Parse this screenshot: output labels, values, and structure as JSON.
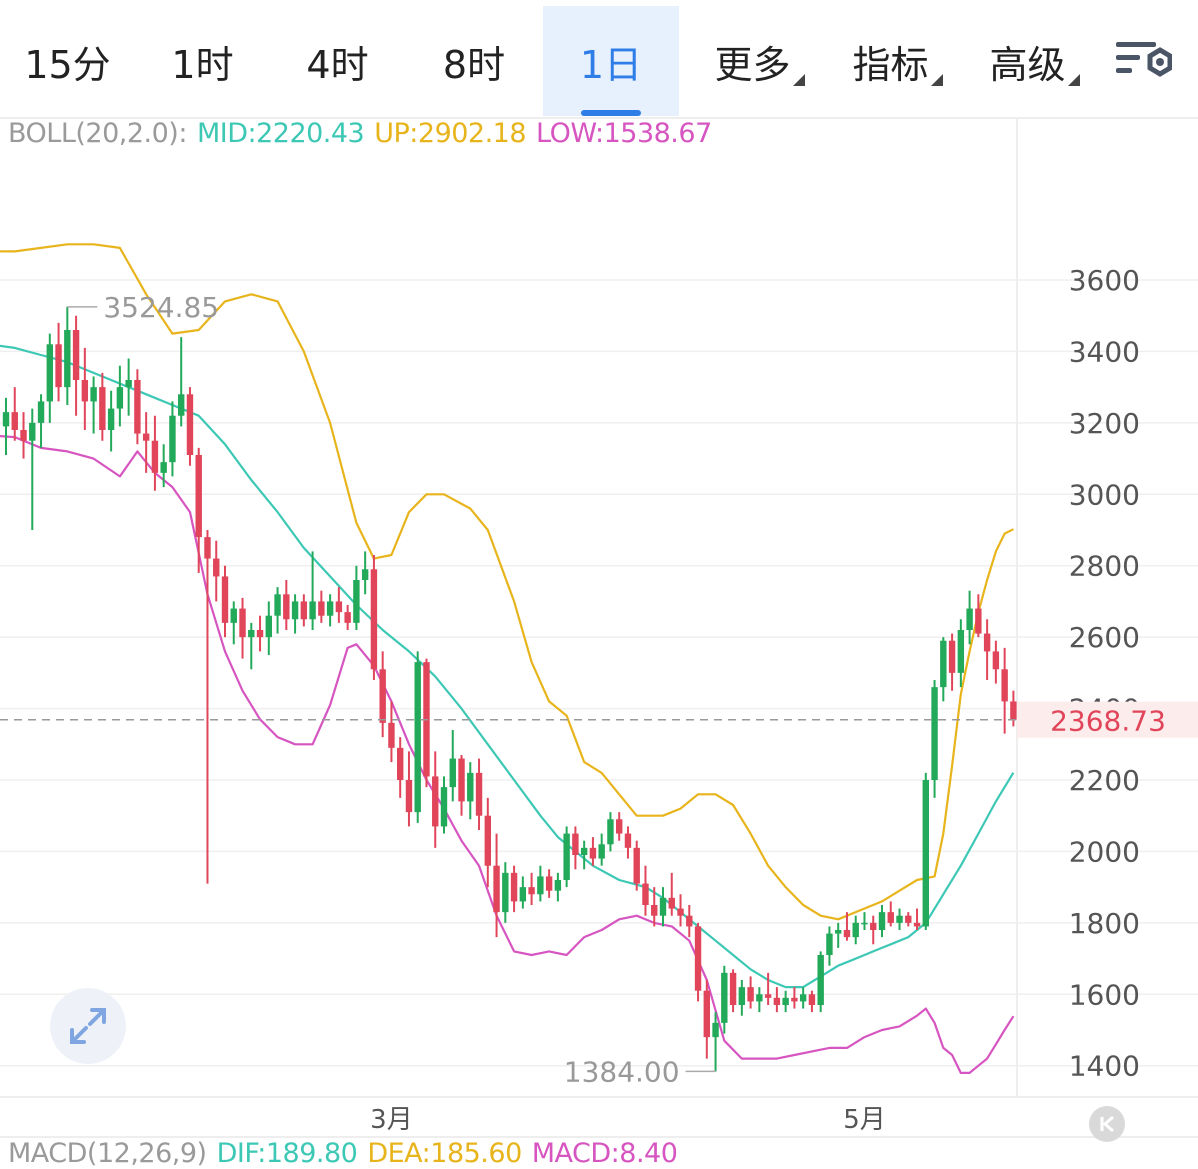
{
  "tabs": [
    {
      "label": "15分",
      "active": false,
      "dropdown": false
    },
    {
      "label": "1时",
      "active": false,
      "dropdown": false
    },
    {
      "label": "4时",
      "active": false,
      "dropdown": false
    },
    {
      "label": "8时",
      "active": false,
      "dropdown": false
    },
    {
      "label": "1日",
      "active": true,
      "dropdown": false
    },
    {
      "label": "更多",
      "active": false,
      "dropdown": true
    },
    {
      "label": "指标",
      "active": false,
      "dropdown": true
    },
    {
      "label": "高级",
      "active": false,
      "dropdown": true
    }
  ],
  "settings_icon": "chart-settings-icon",
  "boll_legend": {
    "name": "BOLL(20,2.0):",
    "mid": "MID:2220.43",
    "up": "UP:2902.18",
    "low": "LOW:1538.67"
  },
  "macd_legend": {
    "name": "MACD(12,26,9)",
    "dif": "DIF:189.80",
    "dea": "DEA:185.60",
    "macd": "MACD:8.40"
  },
  "colors": {
    "up": "#22a95a",
    "down": "#e0455a",
    "mid": "#3cc8b4",
    "upper": "#e8b41c",
    "lower": "#d655c0",
    "current_price_bg": "#fdecec",
    "current_price_text": "#e0455a",
    "axis_text": "#555555",
    "legend_name": "#999999",
    "tab_active": "#2f7ee8"
  },
  "chart_data": {
    "type": "candlestick",
    "period": "1日",
    "ylim": [
      1350,
      3720
    ],
    "y_ticks": [
      1400,
      1600,
      1800,
      2000,
      2200,
      2400,
      2600,
      2800,
      3000,
      3200,
      3400,
      3600
    ],
    "x_labels": [
      {
        "label": "3月",
        "index": 44
      },
      {
        "label": "5月",
        "index": 98
      }
    ],
    "current_price": "2368.73",
    "high_marker": {
      "label": "3524.85",
      "index": 7,
      "value": 3524.85
    },
    "low_marker": {
      "label": "1384.00",
      "index": 81,
      "value": 1384.0
    },
    "ohlc": [
      [
        3190,
        3270,
        3110,
        3230
      ],
      [
        3230,
        3300,
        3150,
        3180
      ],
      [
        3180,
        3230,
        3100,
        3150
      ],
      [
        3150,
        3240,
        2900,
        3200
      ],
      [
        3200,
        3280,
        3130,
        3260
      ],
      [
        3260,
        3450,
        3200,
        3420
      ],
      [
        3420,
        3480,
        3260,
        3300
      ],
      [
        3300,
        3524.85,
        3250,
        3460
      ],
      [
        3460,
        3500,
        3220,
        3320
      ],
      [
        3320,
        3410,
        3180,
        3260
      ],
      [
        3260,
        3330,
        3170,
        3300
      ],
      [
        3300,
        3340,
        3150,
        3180
      ],
      [
        3180,
        3290,
        3120,
        3240
      ],
      [
        3240,
        3360,
        3190,
        3300
      ],
      [
        3300,
        3380,
        3220,
        3320
      ],
      [
        3320,
        3350,
        3140,
        3170
      ],
      [
        3170,
        3230,
        3060,
        3150
      ],
      [
        3150,
        3220,
        3010,
        3060
      ],
      [
        3060,
        3140,
        3020,
        3090
      ],
      [
        3090,
        3260,
        3050,
        3220
      ],
      [
        3220,
        3440,
        3190,
        3280
      ],
      [
        3280,
        3300,
        3080,
        3110
      ],
      [
        3110,
        3130,
        2780,
        2880
      ],
      [
        2880,
        2900,
        1910,
        2820
      ],
      [
        2820,
        2870,
        2700,
        2770
      ],
      [
        2770,
        2800,
        2600,
        2640
      ],
      [
        2640,
        2700,
        2580,
        2680
      ],
      [
        2680,
        2710,
        2540,
        2600
      ],
      [
        2600,
        2640,
        2510,
        2620
      ],
      [
        2620,
        2660,
        2560,
        2600
      ],
      [
        2600,
        2700,
        2550,
        2660
      ],
      [
        2660,
        2740,
        2610,
        2720
      ],
      [
        2720,
        2760,
        2620,
        2650
      ],
      [
        2650,
        2720,
        2610,
        2700
      ],
      [
        2700,
        2720,
        2630,
        2650
      ],
      [
        2650,
        2840,
        2620,
        2700
      ],
      [
        2700,
        2730,
        2640,
        2660
      ],
      [
        2660,
        2720,
        2630,
        2700
      ],
      [
        2700,
        2740,
        2640,
        2670
      ],
      [
        2670,
        2690,
        2620,
        2640
      ],
      [
        2640,
        2800,
        2620,
        2760
      ],
      [
        2760,
        2840,
        2720,
        2790
      ],
      [
        2790,
        2830,
        2480,
        2510
      ],
      [
        2510,
        2560,
        2320,
        2360
      ],
      [
        2360,
        2420,
        2250,
        2290
      ],
      [
        2290,
        2320,
        2150,
        2200
      ],
      [
        2200,
        2280,
        2070,
        2110
      ],
      [
        2110,
        2560,
        2080,
        2530
      ],
      [
        2530,
        2540,
        2180,
        2210
      ],
      [
        2210,
        2280,
        2010,
        2070
      ],
      [
        2070,
        2210,
        2050,
        2180
      ],
      [
        2180,
        2340,
        2140,
        2260
      ],
      [
        2260,
        2270,
        2100,
        2140
      ],
      [
        2140,
        2250,
        2090,
        2220
      ],
      [
        2220,
        2260,
        2060,
        2100
      ],
      [
        2100,
        2150,
        1900,
        1960
      ],
      [
        1960,
        2050,
        1760,
        1830
      ],
      [
        1830,
        1970,
        1800,
        1940
      ],
      [
        1940,
        1960,
        1830,
        1860
      ],
      [
        1860,
        1930,
        1840,
        1900
      ],
      [
        1900,
        1940,
        1850,
        1880
      ],
      [
        1880,
        1960,
        1860,
        1930
      ],
      [
        1930,
        1950,
        1870,
        1890
      ],
      [
        1890,
        1940,
        1860,
        1920
      ],
      [
        1920,
        2070,
        1900,
        2050
      ],
      [
        2050,
        2070,
        1950,
        1990
      ],
      [
        1990,
        2030,
        1950,
        2010
      ],
      [
        2010,
        2040,
        1960,
        1980
      ],
      [
        1980,
        2050,
        1960,
        2020
      ],
      [
        2020,
        2110,
        2000,
        2090
      ],
      [
        2090,
        2110,
        2030,
        2050
      ],
      [
        2050,
        2070,
        1980,
        2010
      ],
      [
        2010,
        2030,
        1890,
        1910
      ],
      [
        1910,
        1960,
        1820,
        1850
      ],
      [
        1850,
        1900,
        1790,
        1820
      ],
      [
        1820,
        1900,
        1790,
        1870
      ],
      [
        1870,
        1940,
        1820,
        1840
      ],
      [
        1840,
        1880,
        1790,
        1820
      ],
      [
        1820,
        1850,
        1760,
        1790
      ],
      [
        1790,
        1800,
        1580,
        1610
      ],
      [
        1610,
        1640,
        1420,
        1480
      ],
      [
        1480,
        1550,
        1384.0,
        1520
      ],
      [
        1520,
        1680,
        1490,
        1660
      ],
      [
        1660,
        1670,
        1550,
        1570
      ],
      [
        1570,
        1640,
        1540,
        1620
      ],
      [
        1620,
        1650,
        1560,
        1580
      ],
      [
        1580,
        1620,
        1550,
        1600
      ],
      [
        1600,
        1660,
        1570,
        1590
      ],
      [
        1590,
        1620,
        1550,
        1570
      ],
      [
        1570,
        1610,
        1550,
        1590
      ],
      [
        1590,
        1620,
        1560,
        1580
      ],
      [
        1580,
        1620,
        1560,
        1600
      ],
      [
        1600,
        1610,
        1550,
        1570
      ],
      [
        1570,
        1720,
        1550,
        1710
      ],
      [
        1710,
        1790,
        1680,
        1770
      ],
      [
        1770,
        1800,
        1730,
        1780
      ],
      [
        1780,
        1830,
        1750,
        1760
      ],
      [
        1760,
        1820,
        1740,
        1800
      ],
      [
        1800,
        1830,
        1780,
        1800
      ],
      [
        1800,
        1820,
        1740,
        1780
      ],
      [
        1780,
        1850,
        1760,
        1830
      ],
      [
        1830,
        1860,
        1790,
        1800
      ],
      [
        1800,
        1840,
        1780,
        1820
      ],
      [
        1820,
        1830,
        1790,
        1800
      ],
      [
        1800,
        1840,
        1780,
        1790
      ],
      [
        1790,
        2220,
        1780,
        2200
      ],
      [
        2200,
        2480,
        2150,
        2460
      ],
      [
        2460,
        2600,
        2420,
        2590
      ],
      [
        2590,
        2610,
        2450,
        2500
      ],
      [
        2500,
        2650,
        2460,
        2620
      ],
      [
        2620,
        2730,
        2580,
        2680
      ],
      [
        2680,
        2720,
        2600,
        2610
      ],
      [
        2610,
        2650,
        2480,
        2560
      ],
      [
        2560,
        2590,
        2470,
        2510
      ],
      [
        2510,
        2570,
        2330,
        2420
      ],
      [
        2420,
        2450,
        2350,
        2368.73
      ]
    ],
    "boll_upper": [
      [
        -5,
        3680
      ],
      [
        1,
        3680
      ],
      [
        4,
        3690
      ],
      [
        7,
        3700
      ],
      [
        10,
        3700
      ],
      [
        13,
        3690
      ],
      [
        16,
        3560
      ],
      [
        19,
        3450
      ],
      [
        22,
        3460
      ],
      [
        25,
        3540
      ],
      [
        28,
        3560
      ],
      [
        31,
        3540
      ],
      [
        34,
        3400
      ],
      [
        37,
        3200
      ],
      [
        40,
        2920
      ],
      [
        42,
        2820
      ],
      [
        44,
        2830
      ],
      [
        46,
        2950
      ],
      [
        48,
        3000
      ],
      [
        50,
        3000
      ],
      [
        53,
        2960
      ],
      [
        55,
        2900
      ],
      [
        58,
        2700
      ],
      [
        60,
        2530
      ],
      [
        62,
        2420
      ],
      [
        64,
        2380
      ],
      [
        66,
        2250
      ],
      [
        68,
        2220
      ],
      [
        70,
        2160
      ],
      [
        72,
        2100
      ],
      [
        75,
        2100
      ],
      [
        77,
        2120
      ],
      [
        79,
        2160
      ],
      [
        81,
        2160
      ],
      [
        83,
        2130
      ],
      [
        85,
        2050
      ],
      [
        87,
        1960
      ],
      [
        89,
        1900
      ],
      [
        91,
        1850
      ],
      [
        93,
        1820
      ],
      [
        95,
        1810
      ],
      [
        97,
        1830
      ],
      [
        100,
        1860
      ],
      [
        102,
        1890
      ],
      [
        104,
        1920
      ],
      [
        106,
        1930
      ],
      [
        107,
        2050
      ],
      [
        108,
        2240
      ],
      [
        109,
        2440
      ],
      [
        110,
        2560
      ],
      [
        111,
        2670
      ],
      [
        112,
        2760
      ],
      [
        113,
        2840
      ],
      [
        114,
        2890
      ],
      [
        115,
        2902.18
      ]
    ],
    "boll_mid": [
      [
        -5,
        3430
      ],
      [
        1,
        3410
      ],
      [
        4,
        3390
      ],
      [
        7,
        3370
      ],
      [
        10,
        3340
      ],
      [
        13,
        3310
      ],
      [
        16,
        3280
      ],
      [
        19,
        3250
      ],
      [
        22,
        3220
      ],
      [
        25,
        3140
      ],
      [
        28,
        3040
      ],
      [
        31,
        2950
      ],
      [
        34,
        2850
      ],
      [
        37,
        2770
      ],
      [
        40,
        2690
      ],
      [
        43,
        2620
      ],
      [
        46,
        2560
      ],
      [
        49,
        2490
      ],
      [
        52,
        2400
      ],
      [
        55,
        2300
      ],
      [
        58,
        2200
      ],
      [
        61,
        2100
      ],
      [
        63,
        2040
      ],
      [
        65,
        2000
      ],
      [
        67,
        1960
      ],
      [
        70,
        1920
      ],
      [
        73,
        1900
      ],
      [
        75,
        1870
      ],
      [
        77,
        1830
      ],
      [
        79,
        1790
      ],
      [
        81,
        1750
      ],
      [
        83,
        1710
      ],
      [
        85,
        1670
      ],
      [
        87,
        1640
      ],
      [
        89,
        1620
      ],
      [
        91,
        1620
      ],
      [
        93,
        1650
      ],
      [
        95,
        1680
      ],
      [
        97,
        1700
      ],
      [
        99,
        1720
      ],
      [
        101,
        1740
      ],
      [
        103,
        1760
      ],
      [
        105,
        1800
      ],
      [
        107,
        1880
      ],
      [
        109,
        1960
      ],
      [
        111,
        2050
      ],
      [
        113,
        2140
      ],
      [
        115,
        2220.43
      ]
    ],
    "boll_lower": [
      [
        -5,
        3170
      ],
      [
        1,
        3160
      ],
      [
        4,
        3130
      ],
      [
        7,
        3120
      ],
      [
        10,
        3100
      ],
      [
        13,
        3050
      ],
      [
        15,
        3120
      ],
      [
        17,
        3060
      ],
      [
        19,
        3020
      ],
      [
        21,
        2950
      ],
      [
        23,
        2720
      ],
      [
        25,
        2560
      ],
      [
        27,
        2450
      ],
      [
        29,
        2370
      ],
      [
        31,
        2320
      ],
      [
        33,
        2300
      ],
      [
        35,
        2300
      ],
      [
        37,
        2410
      ],
      [
        39,
        2570
      ],
      [
        40,
        2580
      ],
      [
        42,
        2520
      ],
      [
        44,
        2420
      ],
      [
        46,
        2300
      ],
      [
        48,
        2200
      ],
      [
        50,
        2120
      ],
      [
        52,
        2030
      ],
      [
        54,
        1960
      ],
      [
        56,
        1820
      ],
      [
        58,
        1720
      ],
      [
        60,
        1710
      ],
      [
        62,
        1720
      ],
      [
        64,
        1710
      ],
      [
        66,
        1760
      ],
      [
        68,
        1780
      ],
      [
        70,
        1810
      ],
      [
        72,
        1820
      ],
      [
        74,
        1800
      ],
      [
        76,
        1790
      ],
      [
        78,
        1750
      ],
      [
        80,
        1640
      ],
      [
        82,
        1470
      ],
      [
        84,
        1420
      ],
      [
        86,
        1420
      ],
      [
        88,
        1420
      ],
      [
        90,
        1430
      ],
      [
        92,
        1440
      ],
      [
        94,
        1450
      ],
      [
        96,
        1450
      ],
      [
        98,
        1480
      ],
      [
        100,
        1500
      ],
      [
        102,
        1510
      ],
      [
        104,
        1540
      ],
      [
        105,
        1560
      ],
      [
        106,
        1520
      ],
      [
        107,
        1450
      ],
      [
        108,
        1430
      ],
      [
        109,
        1380
      ],
      [
        110,
        1380
      ],
      [
        111,
        1400
      ],
      [
        112,
        1420
      ],
      [
        113,
        1460
      ],
      [
        114,
        1500
      ],
      [
        115,
        1538.67
      ]
    ]
  }
}
